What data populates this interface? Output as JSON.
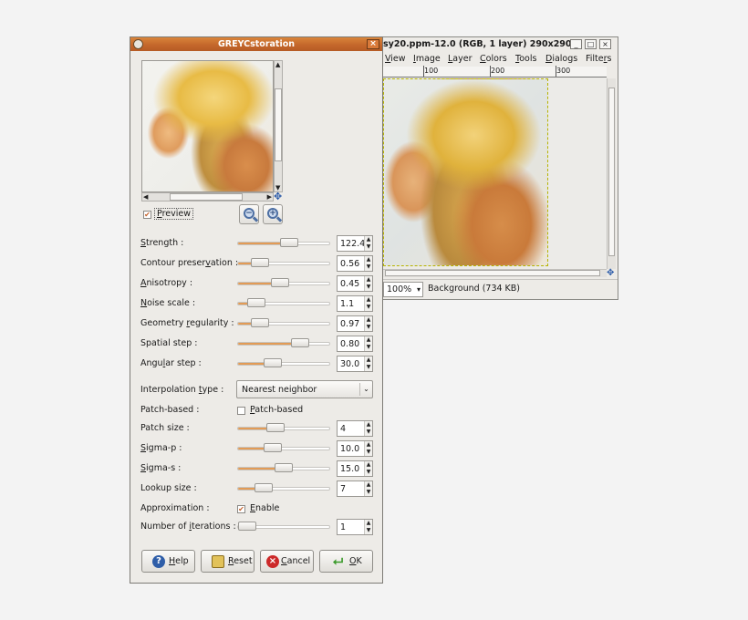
{
  "image_window": {
    "title": "sy20.ppm-12.0 (RGB, 1 layer) 290x290",
    "menu": [
      "View",
      "Image",
      "Layer",
      "Colors",
      "Tools",
      "Dialogs",
      "Filters"
    ],
    "ruler_labels": [
      "100",
      "200",
      "300"
    ],
    "zoom": "100%",
    "layer_info": "Background (734 KB)",
    "window_buttons": [
      "_",
      "□",
      "×"
    ]
  },
  "dialog": {
    "title": "GREYCstoration",
    "close": "×",
    "preview_label": "Preview",
    "preview_checked": true,
    "zoom_out": "−",
    "zoom_in": "+",
    "params": [
      {
        "label": "Strength :",
        "u": "S",
        "value": "122.4",
        "level": 0.58
      },
      {
        "label": "Contour preservation :",
        "u": "v",
        "value": "0.56",
        "level": 0.17
      },
      {
        "label": "Anisotropy :",
        "u": "A",
        "value": "0.45",
        "level": 0.45
      },
      {
        "label": "Noise scale :",
        "u": "N",
        "value": "1.1",
        "level": 0.12
      },
      {
        "label": "Geometry regularity :",
        "u": "r",
        "value": "0.97",
        "level": 0.18
      },
      {
        "label": "Spatial step :",
        "u": "",
        "value": "0.80",
        "level": 0.72
      },
      {
        "label": "Angular step :",
        "u": "l",
        "value": "30.0",
        "level": 0.35
      }
    ],
    "interpolation_label": "Interpolation type :",
    "interpolation_value": "Nearest neighbor",
    "patch_based_label": "Patch-based :",
    "patch_based_check_label": "Patch-based",
    "patch_based_checked": false,
    "params2": [
      {
        "label": "Patch size :",
        "value": "4",
        "level": 0.39
      },
      {
        "label": "Sigma-p :",
        "value": "10.0",
        "level": 0.35
      },
      {
        "label": "Sigma-s :",
        "value": "15.0",
        "level": 0.5
      },
      {
        "label": "Lookup size :",
        "value": "7",
        "level": 0.22
      }
    ],
    "approximation_label": "Approximation :",
    "approximation_check_label": "Enable",
    "approximation_checked": true,
    "iterations_label": "Number of iterations :",
    "iterations_value": "1",
    "iterations_level": 0.0,
    "buttons": {
      "help": "Help",
      "reset": "Reset",
      "cancel": "Cancel",
      "ok": "OK"
    }
  }
}
